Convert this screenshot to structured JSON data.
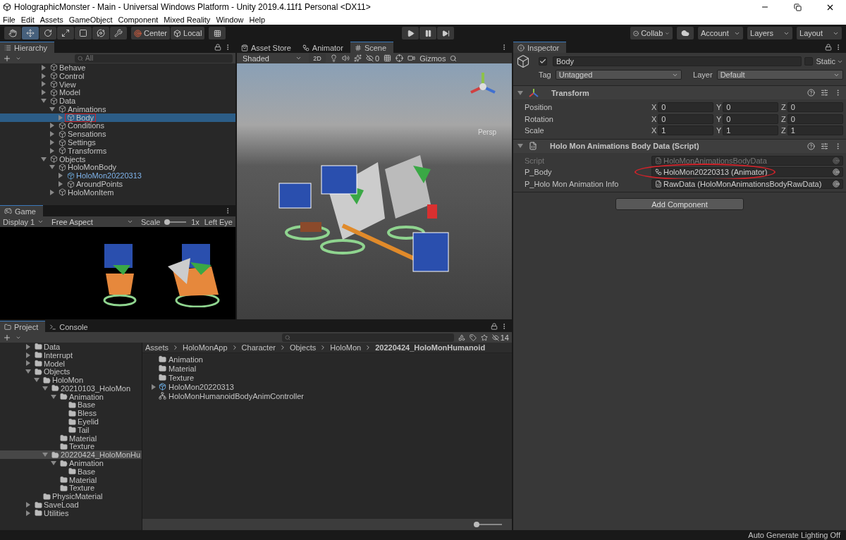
{
  "window": {
    "title": "HolographicMonster - Main - Universal Windows Platform - Unity 2019.4.11f1 Personal <DX11>"
  },
  "menu": [
    "File",
    "Edit",
    "Assets",
    "GameObject",
    "Component",
    "Mixed Reality",
    "Window",
    "Help"
  ],
  "toolbar": {
    "tools": [
      {
        "kind": "hand",
        "selected": false
      },
      {
        "kind": "move",
        "selected": true
      },
      {
        "kind": "rotate",
        "selected": false
      },
      {
        "kind": "scale",
        "selected": false
      },
      {
        "kind": "rect",
        "selected": false
      },
      {
        "kind": "transform",
        "selected": false
      },
      {
        "kind": "custom",
        "selected": false
      }
    ],
    "pivot": [
      "Center",
      "Local"
    ],
    "play": [
      {
        "kind": "play",
        "selected": false
      },
      {
        "kind": "pause",
        "selected": false
      },
      {
        "kind": "step",
        "selected": false
      }
    ],
    "collab": "Collab",
    "account": "Account",
    "layers": "Layers",
    "layout": "Layout"
  },
  "hierarchy": {
    "tab": "Hierarchy",
    "search": {
      "placeholder": "All"
    },
    "items": [
      {
        "label": "Behave",
        "expanded": false,
        "selected": false
      },
      {
        "label": "Control",
        "expanded": false,
        "selected": false
      },
      {
        "label": "View",
        "expanded": false,
        "selected": false
      },
      {
        "label": "Model",
        "expanded": false,
        "selected": false
      },
      {
        "label": "Data",
        "expanded": true,
        "selected": false,
        "children": [
          {
            "label": "Animations",
            "expanded": true,
            "selected": false,
            "children": [
              {
                "label": "Body",
                "expanded": false,
                "selected": true,
                "marked": true
              }
            ]
          },
          {
            "label": "Conditions",
            "expanded": false,
            "selected": false
          },
          {
            "label": "Sensations",
            "expanded": false,
            "selected": false
          },
          {
            "label": "Settings",
            "expanded": false,
            "selected": false
          },
          {
            "label": "Transforms",
            "expanded": false,
            "selected": false
          }
        ]
      },
      {
        "label": "Objects",
        "expanded": true,
        "selected": false,
        "children": [
          {
            "label": "HoloMonBody",
            "expanded": true,
            "selected": false,
            "children": [
              {
                "label": "HoloMon20220313",
                "expanded": false,
                "selected": false,
                "kind": "prefab"
              },
              {
                "label": "AroundPoints",
                "expanded": false,
                "selected": false
              }
            ]
          },
          {
            "label": "HoloMonItem",
            "expanded": false,
            "selected": false
          }
        ]
      }
    ]
  },
  "game": {
    "tab": "Game",
    "display": "Display 1",
    "aspect": "Free Aspect",
    "scale_label": "Scale",
    "scale": {
      "level": 0.1
    },
    "scale_value": "1x",
    "eye": "Left Eye"
  },
  "scene": {
    "tabs": [
      {
        "label": "Asset Store",
        "kind": "store",
        "selected": false
      },
      {
        "label": "Animator",
        "kind": "animator",
        "selected": false
      },
      {
        "label": "Scene",
        "kind": "scene",
        "selected": true
      }
    ],
    "shading": "Shaded",
    "mode_2d": "2D",
    "hidden_count": "0",
    "gizmos": "Gizmos",
    "persp": "Persp"
  },
  "project": {
    "tabs": [
      {
        "label": "Project",
        "kind": "project",
        "selected": true
      },
      {
        "label": "Console",
        "kind": "console",
        "selected": false
      }
    ],
    "hidden_count": "14",
    "tree": [
      {
        "label": "Data",
        "expanded": false,
        "selected": false
      },
      {
        "label": "Interrupt",
        "expanded": false,
        "selected": false
      },
      {
        "label": "Model",
        "expanded": false,
        "selected": false
      },
      {
        "label": "Objects",
        "expanded": true,
        "selected": false,
        "children": [
          {
            "label": "HoloMon",
            "expanded": true,
            "selected": false,
            "children": [
              {
                "label": "20210103_HoloMon",
                "expanded": true,
                "selected": false,
                "children": [
                  {
                    "label": "Animation",
                    "expanded": true,
                    "selected": false,
                    "children": [
                      {
                        "label": "Base",
                        "selected": false
                      },
                      {
                        "label": "Bless",
                        "selected": false
                      },
                      {
                        "label": "Eyelid",
                        "selected": false
                      },
                      {
                        "label": "Tail",
                        "selected": false
                      }
                    ]
                  },
                  {
                    "label": "Material",
                    "selected": false
                  },
                  {
                    "label": "Texture",
                    "selected": false
                  }
                ]
              },
              {
                "label": "20220424_HoloMonHu",
                "expanded": true,
                "selected": true,
                "children": [
                  {
                    "label": "Animation",
                    "expanded": true,
                    "selected": false,
                    "children": [
                      {
                        "label": "Base",
                        "selected": false
                      }
                    ]
                  },
                  {
                    "label": "Material",
                    "selected": false
                  },
                  {
                    "label": "Texture",
                    "selected": false
                  }
                ]
              }
            ]
          },
          {
            "label": "PhysicMaterial",
            "selected": false
          }
        ]
      },
      {
        "label": "SaveLoad",
        "expanded": false,
        "selected": false
      },
      {
        "label": "Utilities",
        "expanded": false,
        "selected": false
      }
    ],
    "breadcrumb": [
      {
        "label": "Assets",
        "selected": false
      },
      {
        "label": "HoloMonApp",
        "selected": false
      },
      {
        "label": "Character",
        "selected": false
      },
      {
        "label": "Objects",
        "selected": false
      },
      {
        "label": "HoloMon",
        "selected": false
      },
      {
        "label": "20220424_HoloMonHumanoid",
        "selected": true
      }
    ],
    "files": [
      {
        "label": "Animation",
        "kind": "folder"
      },
      {
        "label": "Material",
        "kind": "folder"
      },
      {
        "label": "Texture",
        "kind": "folder"
      },
      {
        "label": "HoloMon20220313",
        "kind": "prefab"
      },
      {
        "label": "HoloMonHumanoidBodyAnimController",
        "kind": "controller"
      }
    ],
    "zoom": {
      "level": 0
    }
  },
  "inspector": {
    "tab": "Inspector",
    "name": "Body",
    "active": true,
    "static_label": "Static",
    "static": false,
    "tag_label": "Tag",
    "tag": "Untagged",
    "layer_label": "Layer",
    "layer": "Default",
    "components": [
      {
        "kind": "transform",
        "title": "Transform",
        "expanded": true,
        "rows": [
          {
            "label": "Position",
            "values": [
              {
                "axis": "X",
                "value": "0"
              },
              {
                "axis": "Y",
                "value": "0"
              },
              {
                "axis": "Z",
                "value": "0"
              }
            ]
          },
          {
            "label": "Rotation",
            "values": [
              {
                "axis": "X",
                "value": "0"
              },
              {
                "axis": "Y",
                "value": "0"
              },
              {
                "axis": "Z",
                "value": "0"
              }
            ]
          },
          {
            "label": "Scale",
            "values": [
              {
                "axis": "X",
                "value": "1"
              },
              {
                "axis": "Y",
                "value": "1"
              },
              {
                "axis": "Z",
                "value": "1"
              }
            ]
          }
        ]
      },
      {
        "kind": "script",
        "title": "Holo Mon Animations Body Data (Script)",
        "expanded": true,
        "fields": [
          {
            "label": "Script",
            "value": "HoloMonAnimationsBodyData",
            "kind": "script",
            "disabled": true
          },
          {
            "label": "P_Body",
            "value": "HoloMon20220313 (Animator)",
            "kind": "animator",
            "disabled": false,
            "marked": true
          },
          {
            "label": "P_Holo Mon Animation Info",
            "value": "RawData (HoloMonAnimationsBodyRawData)",
            "kind": "asset",
            "disabled": false
          }
        ]
      }
    ],
    "add_button": "Add Component"
  },
  "status_bar": "Auto Generate Lighting Off"
}
